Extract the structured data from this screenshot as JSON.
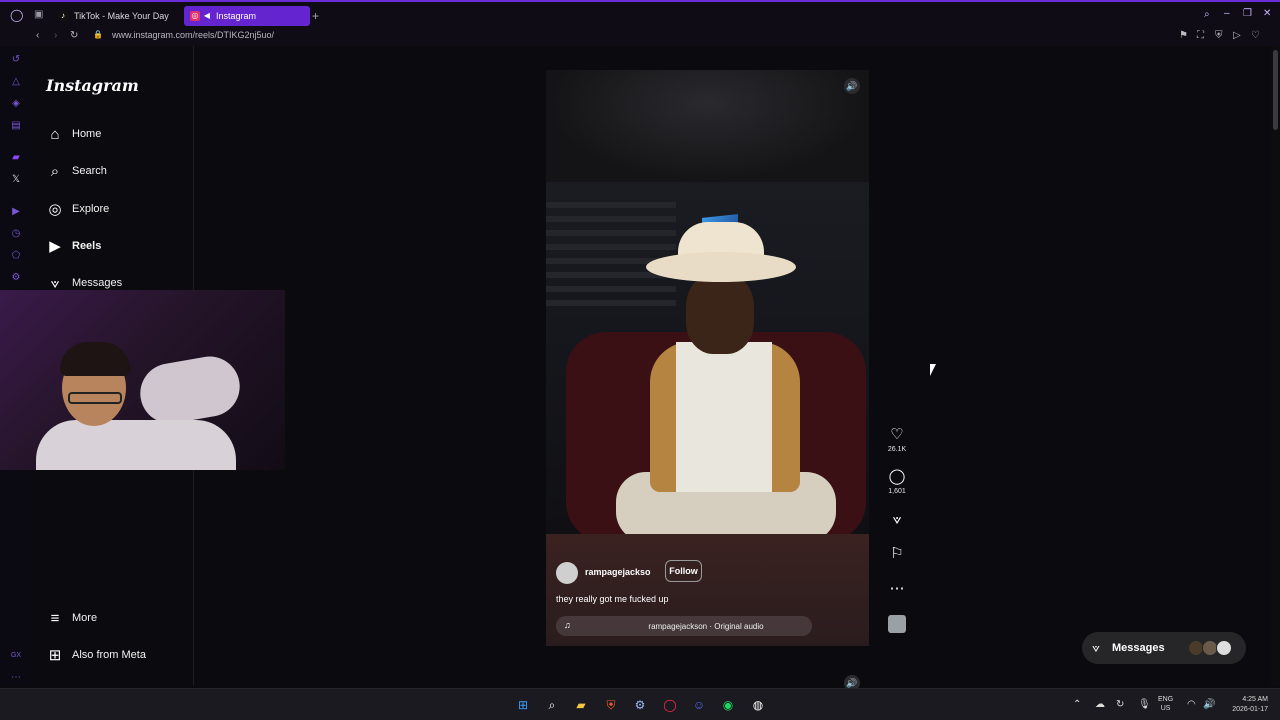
{
  "browser": {
    "tabs": [
      {
        "label": "TikTok - Make Your Day",
        "icon": "tiktok-icon"
      },
      {
        "label": "Instagram",
        "icon": "instagram-icon",
        "active": true
      }
    ],
    "new_tab_glyph": "+",
    "url": "www.instagram.com/reels/DTIKG2nj5uo/",
    "accent_color": "#6424d0"
  },
  "sidebar": {
    "logo": "Instagram",
    "items": [
      {
        "label": "Home",
        "icon": "home-icon"
      },
      {
        "label": "Search",
        "icon": "search-icon"
      },
      {
        "label": "Explore",
        "icon": "compass-icon"
      },
      {
        "label": "Reels",
        "icon": "reels-icon",
        "active": true
      },
      {
        "label": "Messages",
        "icon": "messages-icon"
      }
    ],
    "bottom": [
      {
        "label": "More",
        "icon": "menu-icon"
      },
      {
        "label": "Also from Meta",
        "icon": "meta-apps-icon"
      }
    ]
  },
  "reel": {
    "username": "rampagejackso",
    "follow_label": "Follow",
    "caption": "they really got me fucked up",
    "audio": "rampagejackson · Original audio",
    "likes": "26.1K",
    "comments": "1,601"
  },
  "messages_pill": {
    "label": "Messages"
  },
  "taskbar": {
    "lang_top": "ENG",
    "lang_bottom": "US",
    "time": "4:25 AM",
    "date": "2026-01-17"
  }
}
